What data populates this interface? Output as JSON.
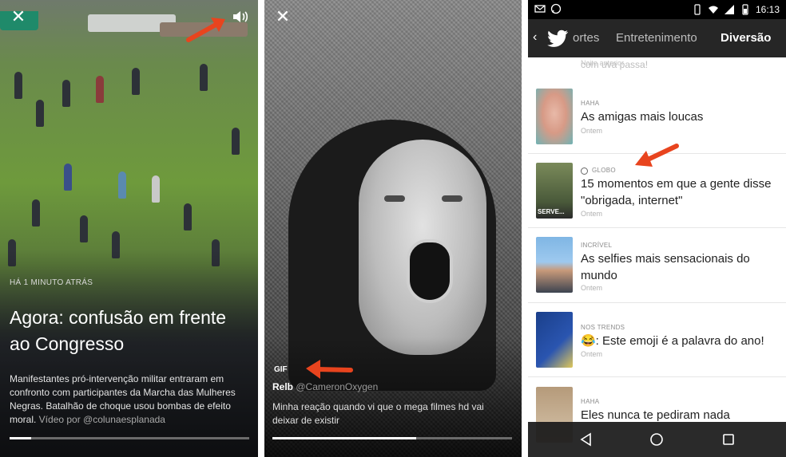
{
  "panel1": {
    "time_label": "HÁ 1 MINUTO ATRÁS",
    "title": "Agora: confusão em frente ao Congresso",
    "description": "Manifestantes pró-intervenção militar entraram em confronto com participantes da Marcha das Mulheres Negras. Batalhão de choque usou bombas de efeito moral.",
    "credit": " Vídeo por @colunaesplanada",
    "progress": 0.09
  },
  "panel2": {
    "badge": "GIF",
    "handle_name": "Relb",
    "handle_user": " @CameronOxygen",
    "description": "Minha reação quando vi que o mega filmes hd vai deixar de existir",
    "progress": 0.6
  },
  "panel3": {
    "status": {
      "time": "16:13"
    },
    "tabs": [
      "ortes",
      "Entretenimento",
      "Diversão"
    ],
    "ghost_lines": [
      "com uva passa!",
      "Noite anterior"
    ],
    "items": [
      {
        "category": "HAHA",
        "title": "As amigas mais loucas",
        "when": "Ontem"
      },
      {
        "category": "GLOBO",
        "title": "15 momentos em que a gente disse \"obrigada, internet\"",
        "when": "Ontem",
        "thumb_text": "SERVE..."
      },
      {
        "category": "INCRÍVEL",
        "title": "As selfies mais sensacionais do mundo",
        "when": "Ontem"
      },
      {
        "category": "NOS TRENDS",
        "title": "😂: Este emoji é a palavra do ano!",
        "when": "Ontem"
      },
      {
        "category": "HAHA",
        "title": "Eles nunca te pediram nada",
        "when": ""
      }
    ]
  },
  "colors": {
    "arrow": "#e8441e",
    "tab_bg": "#262626",
    "accent": "#ffffff"
  }
}
